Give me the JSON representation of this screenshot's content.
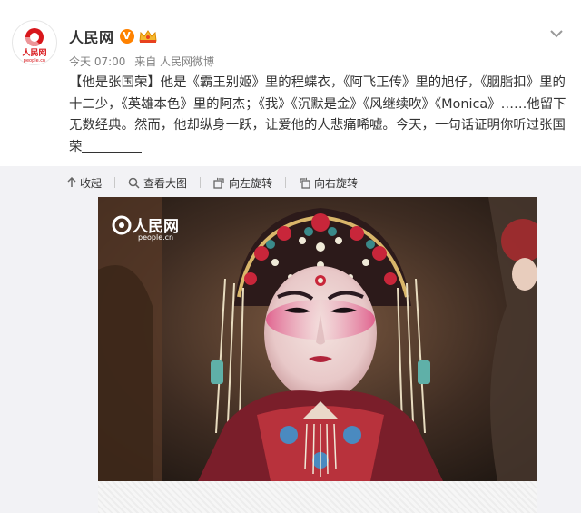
{
  "post": {
    "author": "人民网",
    "avatar_text": "人民网",
    "avatar_sub": "people.cn",
    "verified_mark": "V",
    "time": "今天 07:00",
    "source": "来自 人民网微博",
    "text_tag": "【他是张国荣】",
    "text_body": "他是《霸王别姬》里的程蝶衣，《阿飞正传》里的旭仔，《胭脂扣》里的十二少，《英雄本色》里的阿杰；《我》《沉默是金》《风继续吹》《Monica》……他留下无数经典。然而，他却纵身一跃，让爱他的人悲痛唏嘘。今天，一句话证明你听过张国荣"
  },
  "toolbar": {
    "collapse": "收起",
    "view_large": "查看大图",
    "rotate_left": "向左旋转",
    "rotate_right": "向右旋转"
  },
  "photo": {
    "watermark_text": "人民网",
    "watermark_sub": "people.cn"
  },
  "colors": {
    "brand_red": "#d8161b",
    "verified_orange": "#ff8200",
    "page_gray": "#f2f2f5"
  },
  "icons": [
    "more-arrow-icon",
    "collapse-arrow-icon",
    "zoom-icon",
    "rotate-left-icon",
    "rotate-right-icon",
    "crown-badge-icon"
  ]
}
